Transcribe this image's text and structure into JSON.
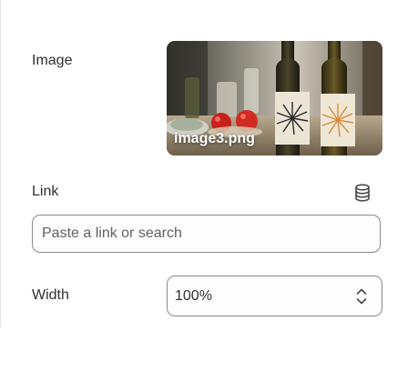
{
  "image_section": {
    "label": "Image",
    "filename": "image3.png"
  },
  "link_section": {
    "label": "Link",
    "icon": "database-icon",
    "placeholder": "Paste a link or search",
    "value": ""
  },
  "width_section": {
    "label": "Width",
    "value": "100%",
    "icon": "select-chevrons-icon"
  }
}
